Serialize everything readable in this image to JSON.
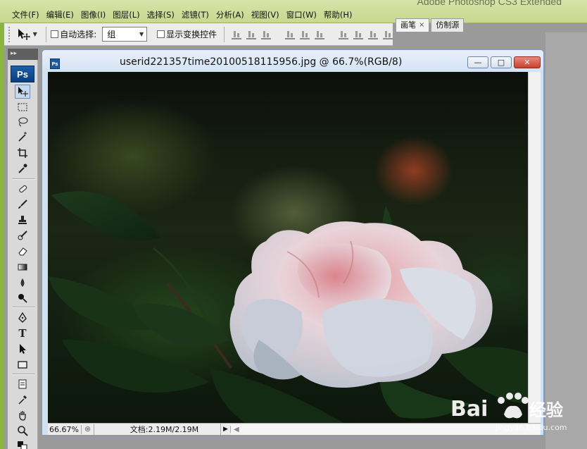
{
  "app": {
    "title": "Adobe Photoshop CS3 Extended"
  },
  "menu": [
    {
      "label": "文件(F)"
    },
    {
      "label": "编辑(E)"
    },
    {
      "label": "图像(I)"
    },
    {
      "label": "图层(L)"
    },
    {
      "label": "选择(S)"
    },
    {
      "label": "滤镜(T)"
    },
    {
      "label": "分析(A)"
    },
    {
      "label": "视图(V)"
    },
    {
      "label": "窗口(W)"
    },
    {
      "label": "帮助(H)"
    }
  ],
  "panel_tabs": [
    {
      "label": "画笔",
      "close": "×"
    },
    {
      "label": "仿制源"
    }
  ],
  "options": {
    "auto_select_label": "自动选择:",
    "auto_select_value": "组",
    "show_transform_label": "显示变换控件"
  },
  "tools": {
    "header": "▸▸",
    "logo": "Ps",
    "items": [
      "move-tool",
      "marquee-tool",
      "lasso-tool",
      "magic-wand-tool",
      "crop-tool",
      "eyedropper-slice-tool",
      "healing-brush-tool",
      "brush-tool",
      "clone-stamp-tool",
      "history-brush-tool",
      "eraser-tool",
      "gradient-tool",
      "blur-tool",
      "dodge-tool",
      "pen-tool",
      "type-tool",
      "path-selection-tool",
      "shape-tool",
      "notes-tool",
      "eyedropper-tool",
      "hand-tool",
      "zoom-tool"
    ],
    "type_glyph": "T"
  },
  "document": {
    "icon_text": "Ps",
    "title": "userid221357time20100518115956.jpg @ 66.7%(RGB/8)",
    "min_glyph": "—",
    "max_glyph": "□",
    "close_glyph": "✕",
    "zoom": "66.67%",
    "doc_size": "文档:2.19M/2.19M",
    "arrow_glyph": "▶",
    "scroll_left_glyph": "◀"
  },
  "watermark": {
    "brand": "Bai",
    "brand_suffix": "经验",
    "url": "jingyan.baidu.com"
  },
  "colors": {
    "accent_green": "#8ab63b",
    "close_red": "#c8402c",
    "ps_blue": "#1c5aa6"
  }
}
